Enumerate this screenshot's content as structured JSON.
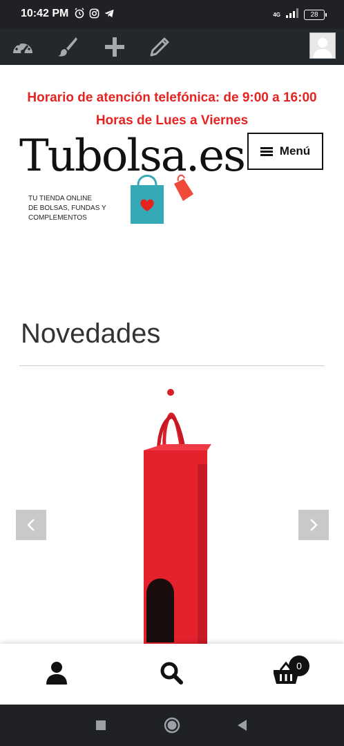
{
  "status_bar": {
    "time": "10:42 PM",
    "network": "4G",
    "battery": "28",
    "icons": [
      "alarm-icon",
      "instagram-icon",
      "telegram-icon",
      "signal-icon",
      "battery-icon"
    ]
  },
  "admin_bar": {
    "icons": [
      "dashboard-icon",
      "customize-brush-icon",
      "add-new-icon",
      "edit-pencil-icon",
      "user-avatar-icon"
    ]
  },
  "header": {
    "notice_line1": "Horario de atención telefónica: de 9:00 a 16:00",
    "notice_line2": "Horas de Lues a Viernes",
    "notice_color": "#e52421",
    "logo_text": "Tubolsa.es",
    "logo_tagline": [
      "TU TIENDA ONLINE",
      "DE BOLSAS, FUNDAS Y",
      "COMPLEMENTOS"
    ],
    "menu_label": "Menú"
  },
  "main": {
    "section_title": "Novedades",
    "slider": {
      "prev_icon": "chevron-left-icon",
      "next_icon": "chevron-right-icon",
      "product_image": "red-wine-bag-image"
    }
  },
  "bottom_bar": {
    "account_icon": "account-icon",
    "search_icon": "search-icon",
    "cart_icon": "basket-icon",
    "cart_count": "0"
  },
  "nav_bar": {
    "icons": [
      "recents-icon",
      "home-icon",
      "back-icon"
    ]
  }
}
